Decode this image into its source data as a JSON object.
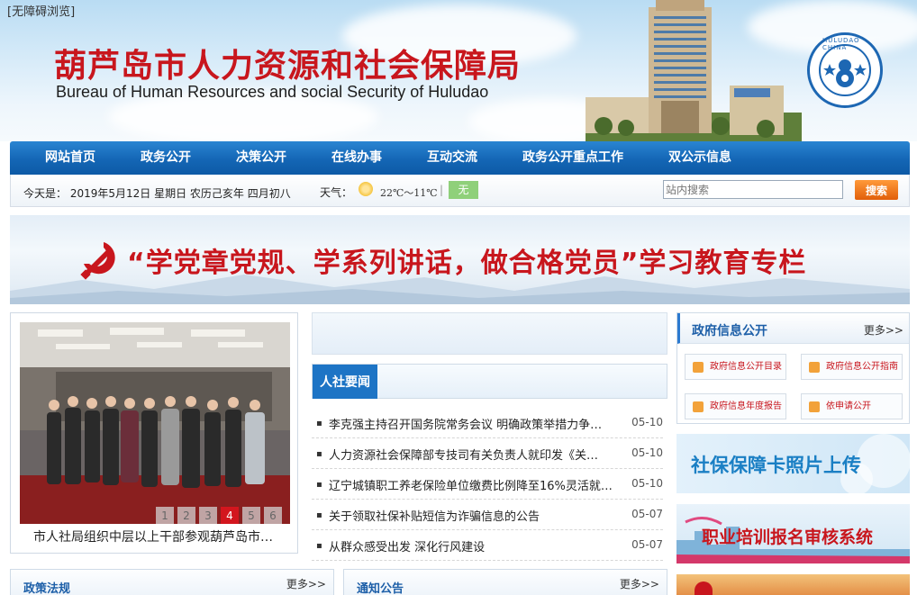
{
  "header": {
    "accessibility_link": "[无障碍浏览]",
    "title_cn": "葫芦岛市人力资源和社会保障局",
    "title_en": "Bureau of Human Resources and social Security of Huludao",
    "logo_text": "HULUDAO CHINA"
  },
  "nav": {
    "items": [
      "网站首页",
      "政务公开",
      "决策公开",
      "在线办事",
      "互动交流",
      "政务公开重点工作",
      "双公示信息"
    ]
  },
  "infobar": {
    "today": "今天是：  2019年5月12日  星期日  农历己亥年  四月初八",
    "weather_label": "天气：",
    "weather_temp": "22℃～11℃",
    "air_quality": "无",
    "search_placeholder": "站内搜索",
    "search_button": "搜索"
  },
  "banner": {
    "text": "“学党章党规、学系列讲话，做合格党员”学习教育专栏"
  },
  "photo": {
    "caption": "市人社局组织中层以上干部参观葫芦岛市…",
    "pages": [
      "1",
      "2",
      "3",
      "4",
      "5",
      "6"
    ],
    "active_page": "4"
  },
  "news": {
    "tab_label": "人社要闻",
    "items": [
      {
        "title": "李克强主持召开国务院常务会议 明确政策举措力争…",
        "date": "05-10"
      },
      {
        "title": "人力资源社会保障部专技司有关负责人就印发《关…",
        "date": "05-10"
      },
      {
        "title": "辽宁城镇职工养老保险单位缴费比例降至16%灵活就…",
        "date": "05-10"
      },
      {
        "title": "关于领取社保补贴短信为诈骗信息的公告",
        "date": "05-07"
      },
      {
        "title": "从群众感受出发 深化行风建设",
        "date": "05-07"
      }
    ]
  },
  "gov_info": {
    "title": "政府信息公开",
    "more": "更多>>",
    "buttons": [
      "政府信息公开目录",
      "政府信息公开指南",
      "政府信息年度报告",
      "依申请公开"
    ]
  },
  "promos": {
    "photo_upload": "社保保障卡照片上传",
    "training": "职业培训报名审核系统"
  },
  "sections": {
    "policy": {
      "title": "政策法规",
      "more": "更多>>"
    },
    "notice": {
      "title": "通知公告",
      "more": "更多>>"
    }
  },
  "colors": {
    "brand_red": "#c8161d",
    "nav_blue": "#1466b5",
    "accent_blue": "#1d5fa8",
    "search_orange": "#e15f0a"
  }
}
